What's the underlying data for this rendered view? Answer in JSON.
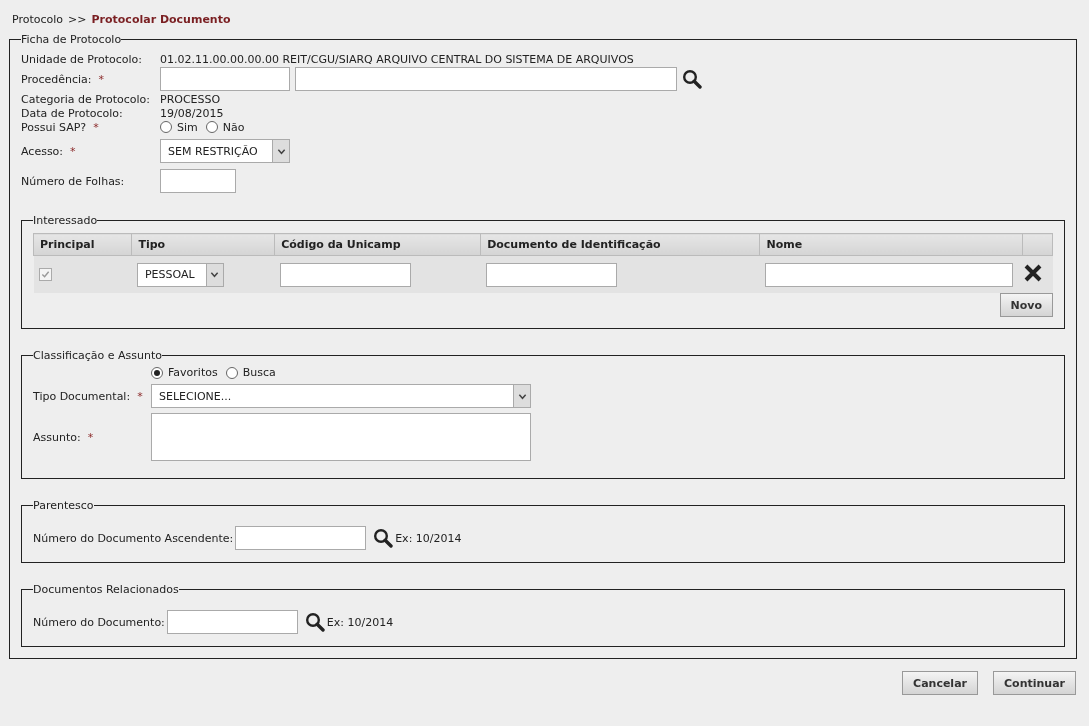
{
  "breadcrumb": {
    "parent": "Protocolo",
    "separator": ">>",
    "current": "Protocolar Documento"
  },
  "ficha": {
    "legend": "Ficha de Protocolo",
    "fields": [
      {
        "kind": "text",
        "label": "Unidade de Protocolo:",
        "value": "01.02.11.00.00.00.00 REIT/CGU/SIARQ ARQUIVO CENTRAL DO SISTEMA DE ARQUIVOS"
      },
      {
        "kind": "lookup",
        "label": "Procedência:",
        "required_mark": "*"
      },
      {
        "kind": "text",
        "label": "Categoria de Protocolo:",
        "value": "PROCESSO"
      },
      {
        "kind": "text",
        "label": "Data de Protocolo:",
        "value": "19/08/2015"
      },
      {
        "kind": "radios",
        "label": "Possui SAP?",
        "required_mark": "*",
        "options": [
          {
            "label": "Sim",
            "selected": false
          },
          {
            "label": "Não",
            "selected": false
          }
        ]
      },
      {
        "kind": "select",
        "label": "Acesso:",
        "required_mark": "*",
        "value": "SEM RESTRIÇÃO"
      },
      {
        "kind": "input",
        "label": "Número de Folhas:"
      }
    ]
  },
  "interessado": {
    "legend": "Interessado",
    "columns": [
      "Principal",
      "Tipo",
      "Código da Unicamp",
      "Documento de Identificação",
      "Nome"
    ],
    "rows": [
      {
        "principal": {
          "checked": true,
          "disabled": true
        },
        "tipo": "PESSOAL"
      }
    ],
    "add_button": "Novo"
  },
  "classificacao": {
    "legend": "Classificação e Assunto",
    "modes": [
      {
        "label": "Favoritos",
        "selected": true
      },
      {
        "label": "Busca",
        "selected": false
      }
    ],
    "tipo_documental": {
      "label": "Tipo Documental:",
      "required_mark": "*",
      "value": "SELECIONE..."
    },
    "assunto": {
      "label": "Assunto:",
      "required_mark": "*"
    }
  },
  "parentesco": {
    "legend": "Parentesco",
    "label": "Número do Documento Ascendente:",
    "hint": "Ex: 10/2014"
  },
  "relacionados": {
    "legend": "Documentos Relacionados",
    "label": "Número do Documento:",
    "hint": "Ex: 10/2014"
  },
  "buttons": [
    "Cancelar",
    "Continuar"
  ]
}
